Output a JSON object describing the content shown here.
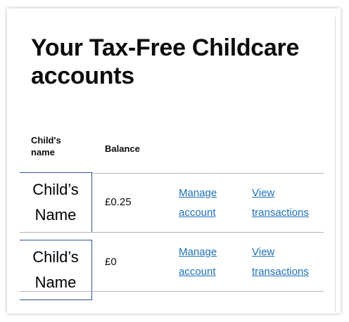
{
  "page": {
    "title": "Your Tax-Free Childcare accounts"
  },
  "table": {
    "headers": {
      "child_name": "Child's name",
      "balance": "Balance"
    },
    "rows": [
      {
        "child_name": "Child’s Name",
        "balance": "£0.25",
        "manage_link": "Manage account",
        "view_link": "View transactions"
      },
      {
        "child_name": "Child’s Name",
        "balance": "£0",
        "manage_link": "Manage account",
        "view_link": "View transactions"
      }
    ]
  },
  "colors": {
    "link": "#1d70b8",
    "text": "#0b0c0c",
    "name_box_border": "#2f5597"
  }
}
